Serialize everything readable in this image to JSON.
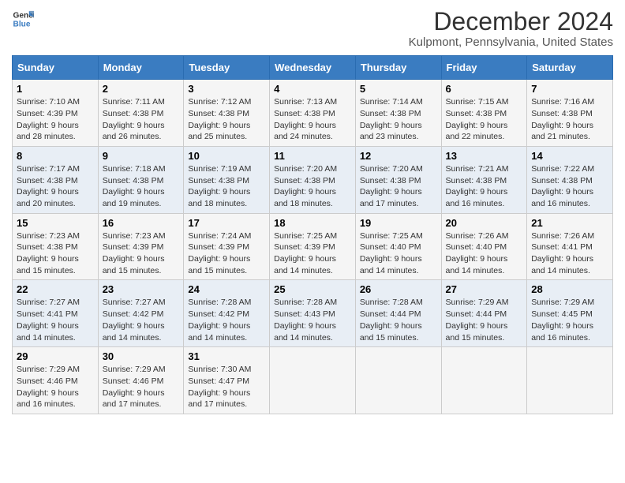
{
  "logo": {
    "text_general": "General",
    "text_blue": "Blue"
  },
  "header": {
    "title": "December 2024",
    "subtitle": "Kulpmont, Pennsylvania, United States"
  },
  "weekdays": [
    "Sunday",
    "Monday",
    "Tuesday",
    "Wednesday",
    "Thursday",
    "Friday",
    "Saturday"
  ],
  "weeks": [
    [
      {
        "day": "1",
        "sunrise": "7:10 AM",
        "sunset": "4:39 PM",
        "daylight": "9 hours and 28 minutes."
      },
      {
        "day": "2",
        "sunrise": "7:11 AM",
        "sunset": "4:38 PM",
        "daylight": "9 hours and 26 minutes."
      },
      {
        "day": "3",
        "sunrise": "7:12 AM",
        "sunset": "4:38 PM",
        "daylight": "9 hours and 25 minutes."
      },
      {
        "day": "4",
        "sunrise": "7:13 AM",
        "sunset": "4:38 PM",
        "daylight": "9 hours and 24 minutes."
      },
      {
        "day": "5",
        "sunrise": "7:14 AM",
        "sunset": "4:38 PM",
        "daylight": "9 hours and 23 minutes."
      },
      {
        "day": "6",
        "sunrise": "7:15 AM",
        "sunset": "4:38 PM",
        "daylight": "9 hours and 22 minutes."
      },
      {
        "day": "7",
        "sunrise": "7:16 AM",
        "sunset": "4:38 PM",
        "daylight": "9 hours and 21 minutes."
      }
    ],
    [
      {
        "day": "8",
        "sunrise": "7:17 AM",
        "sunset": "4:38 PM",
        "daylight": "9 hours and 20 minutes."
      },
      {
        "day": "9",
        "sunrise": "7:18 AM",
        "sunset": "4:38 PM",
        "daylight": "9 hours and 19 minutes."
      },
      {
        "day": "10",
        "sunrise": "7:19 AM",
        "sunset": "4:38 PM",
        "daylight": "9 hours and 18 minutes."
      },
      {
        "day": "11",
        "sunrise": "7:20 AM",
        "sunset": "4:38 PM",
        "daylight": "9 hours and 18 minutes."
      },
      {
        "day": "12",
        "sunrise": "7:20 AM",
        "sunset": "4:38 PM",
        "daylight": "9 hours and 17 minutes."
      },
      {
        "day": "13",
        "sunrise": "7:21 AM",
        "sunset": "4:38 PM",
        "daylight": "9 hours and 16 minutes."
      },
      {
        "day": "14",
        "sunrise": "7:22 AM",
        "sunset": "4:38 PM",
        "daylight": "9 hours and 16 minutes."
      }
    ],
    [
      {
        "day": "15",
        "sunrise": "7:23 AM",
        "sunset": "4:38 PM",
        "daylight": "9 hours and 15 minutes."
      },
      {
        "day": "16",
        "sunrise": "7:23 AM",
        "sunset": "4:39 PM",
        "daylight": "9 hours and 15 minutes."
      },
      {
        "day": "17",
        "sunrise": "7:24 AM",
        "sunset": "4:39 PM",
        "daylight": "9 hours and 15 minutes."
      },
      {
        "day": "18",
        "sunrise": "7:25 AM",
        "sunset": "4:39 PM",
        "daylight": "9 hours and 14 minutes."
      },
      {
        "day": "19",
        "sunrise": "7:25 AM",
        "sunset": "4:40 PM",
        "daylight": "9 hours and 14 minutes."
      },
      {
        "day": "20",
        "sunrise": "7:26 AM",
        "sunset": "4:40 PM",
        "daylight": "9 hours and 14 minutes."
      },
      {
        "day": "21",
        "sunrise": "7:26 AM",
        "sunset": "4:41 PM",
        "daylight": "9 hours and 14 minutes."
      }
    ],
    [
      {
        "day": "22",
        "sunrise": "7:27 AM",
        "sunset": "4:41 PM",
        "daylight": "9 hours and 14 minutes."
      },
      {
        "day": "23",
        "sunrise": "7:27 AM",
        "sunset": "4:42 PM",
        "daylight": "9 hours and 14 minutes."
      },
      {
        "day": "24",
        "sunrise": "7:28 AM",
        "sunset": "4:42 PM",
        "daylight": "9 hours and 14 minutes."
      },
      {
        "day": "25",
        "sunrise": "7:28 AM",
        "sunset": "4:43 PM",
        "daylight": "9 hours and 14 minutes."
      },
      {
        "day": "26",
        "sunrise": "7:28 AM",
        "sunset": "4:44 PM",
        "daylight": "9 hours and 15 minutes."
      },
      {
        "day": "27",
        "sunrise": "7:29 AM",
        "sunset": "4:44 PM",
        "daylight": "9 hours and 15 minutes."
      },
      {
        "day": "28",
        "sunrise": "7:29 AM",
        "sunset": "4:45 PM",
        "daylight": "9 hours and 16 minutes."
      }
    ],
    [
      {
        "day": "29",
        "sunrise": "7:29 AM",
        "sunset": "4:46 PM",
        "daylight": "9 hours and 16 minutes."
      },
      {
        "day": "30",
        "sunrise": "7:29 AM",
        "sunset": "4:46 PM",
        "daylight": "9 hours and 17 minutes."
      },
      {
        "day": "31",
        "sunrise": "7:30 AM",
        "sunset": "4:47 PM",
        "daylight": "9 hours and 17 minutes."
      },
      null,
      null,
      null,
      null
    ]
  ],
  "labels": {
    "sunrise": "Sunrise:",
    "sunset": "Sunset:",
    "daylight": "Daylight:"
  }
}
